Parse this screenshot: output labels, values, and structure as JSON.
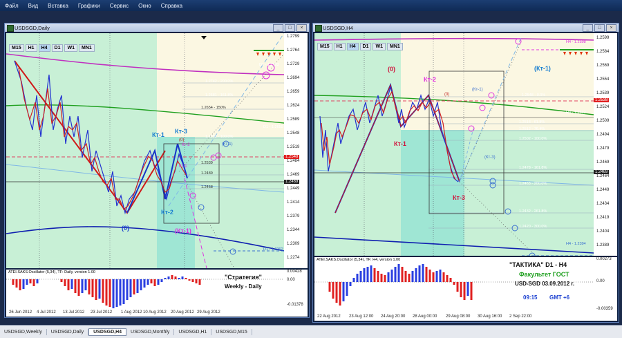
{
  "menu": [
    "Файл",
    "Вид",
    "Вставка",
    "Графики",
    "Сервис",
    "Окно",
    "Справка"
  ],
  "tabs": [
    {
      "label": "USDSGD,Weekly",
      "active": false
    },
    {
      "label": "USDSGD,Daily",
      "active": false
    },
    {
      "label": "USDSGD,H4",
      "active": true
    },
    {
      "label": "USDSGD,Monthly",
      "active": false
    },
    {
      "label": "USDSGD,H1",
      "active": false
    },
    {
      "label": "USDSGD,M15",
      "active": false
    }
  ],
  "timeframes": [
    "M15",
    "H1",
    "H4",
    "D1",
    "W1",
    "MN1"
  ],
  "left": {
    "title": "USDSGD,Daily",
    "active_tf": "H4",
    "y_ticks": [
      "1.2799",
      "1.2764",
      "1.2729",
      "1.2694",
      "1.2659",
      "1.2624",
      "1.2589",
      "1.2548",
      "1.2519",
      "1.2484",
      "1.2469",
      "1.2449",
      "1.2414",
      "1.2379",
      "1.2344",
      "1.2309",
      "1.2274"
    ],
    "price_tag": "1.2548",
    "price_tag2": "1.2469",
    "osc_label": "ATEI.SAKS.Oscillator (5,34), TF: Daily, version 1.00",
    "osc_ticks": [
      "0.00428",
      "0.00",
      "-0.01378"
    ],
    "x_ticks": [
      "26 Jun 2012",
      "4 Jul 2012",
      "13 Jul 2012",
      "23 Jul 2012",
      "1 Aug 2012",
      "10 Aug 2012",
      "20 Aug 2012",
      "29 Aug 2012"
    ],
    "labels": {
      "kt1": "Кт-1",
      "kt3": "Кт-3",
      "kt2": "Кт-2",
      "zero": "(0)",
      "kt1p": "(Кт-1)",
      "kt2small": "Кт-2",
      "kt1small": "Кт-1",
      "zeroSmall": "(0)",
      "kt1s": "(Кт-1)"
    },
    "fib": [
      "1.2742 - 200.0%",
      "1.2681 - 161.8%",
      "1.2654 - 150%",
      "1.2552 - 100.0%",
      "1.2539",
      "1.2489",
      "1.2458",
      "D1 - 1.2659",
      "D1 - 1.2302",
      "D1 - 1.2783"
    ],
    "strategy_title": "\"Стратегия\"",
    "strategy_sub": "Weekly - Daily"
  },
  "right": {
    "title": "USDSGD,H4",
    "active_tf": "H4",
    "y_ticks": [
      "1.2599",
      "1.2584",
      "1.2569",
      "1.2554",
      "1.2539",
      "1.2524",
      "1.2509",
      "1.2494",
      "1.2479",
      "1.2469",
      "1.2464",
      "1.2449",
      "1.2434",
      "1.2419",
      "1.2404",
      "1.2389"
    ],
    "price_tag": "1.2538",
    "price_tag2": "1.2469",
    "osc_label": "ATEI.SAKS.Oscillator (5,34), TF: H4, version 1.00",
    "osc_ticks": [
      "0.00273",
      "0.00",
      "-0.00359"
    ],
    "x_ticks": [
      "22 Aug 2012",
      "23 Aug 12:00",
      "24 Aug 20:00",
      "28 Aug 00:00",
      "29 Aug 08:00",
      "30 Aug 16:00",
      "2 Sep 22:00"
    ],
    "labels": {
      "zero": "(0)",
      "kt2": "Кт-2",
      "kt1": "Кт-1",
      "kt3": "Кт-3",
      "kt1p": "(Кт-1)",
      "kt1small": "(Кт-1)",
      "kt3small": "(Кт-3)",
      "zeroSmall": "(0)"
    },
    "fib": [
      "1.2548 - 0.0%",
      "1.2518 - 61.8%",
      "1.2512 - 76.4%",
      "1.2502 - 100.0%",
      "1.2478 - 161.8%",
      "1.2463 - 200.0%",
      "1.2432 - 261.8%",
      "1.2420 - 300.0%",
      "H4 - 1.2598",
      "H4 - 1.2394",
      "H4 - 1.2502"
    ],
    "tactic_title": "\"ТАКТИКА\"   D1 - H4",
    "tactic_sub": "Факультет ГОСТ",
    "tactic_pair": "USD-SGD   03.09.2012 г.",
    "tactic_time": "09:15",
    "tactic_gmt": "GMT +6"
  },
  "colors": {
    "chart_bg": "#c8f0d6",
    "up_line": "#1533c8",
    "down_line": "#d01818",
    "accent_magenta": "#e030e0",
    "accent_green": "#20b020",
    "label_blue": "#1a7fd0",
    "label_red": "#d0103a"
  }
}
